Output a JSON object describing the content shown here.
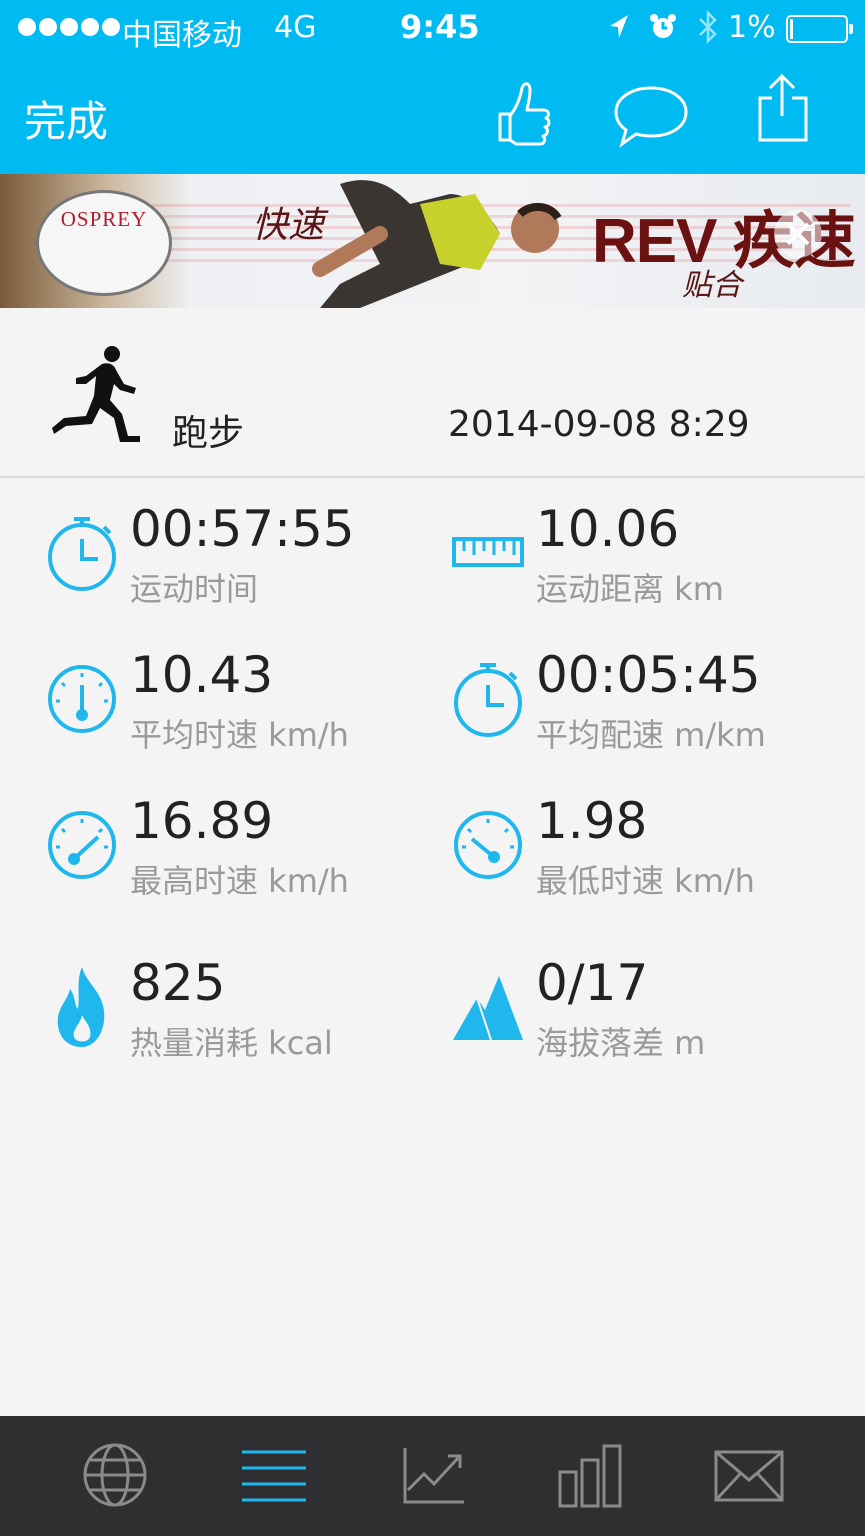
{
  "status_bar": {
    "carrier": "中国移动",
    "network": "4G",
    "time": "9:45",
    "battery": "1%"
  },
  "nav": {
    "done_label": "完成",
    "icons": [
      "thumbs-up-icon",
      "comment-icon",
      "share-icon"
    ]
  },
  "ad": {
    "logo": "OSPREY",
    "tagline_1": "快速",
    "brand": "REV 疾速",
    "tagline_2": "贴合"
  },
  "activity": {
    "type": "跑步",
    "datetime": "2014-09-08 8:29"
  },
  "stats": [
    {
      "value": "00:57:55",
      "label": "运动时间",
      "icon": "stopwatch-icon"
    },
    {
      "value": "10.06",
      "label": "运动距离 km",
      "icon": "ruler-icon"
    },
    {
      "value": "10.43",
      "label": "平均时速 km/h",
      "icon": "gauge-icon"
    },
    {
      "value": "00:05:45",
      "label": "平均配速 m/km",
      "icon": "stopwatch-icon"
    },
    {
      "value": "16.89",
      "label": "最高时速 km/h",
      "icon": "speedometer-high-icon"
    },
    {
      "value": "1.98",
      "label": "最低时速 km/h",
      "icon": "speedometer-low-icon"
    },
    {
      "value": "825",
      "label": "热量消耗 kcal",
      "icon": "flame-icon"
    },
    {
      "value": "0/17",
      "label": "海拔落差 m",
      "icon": "mountain-icon"
    }
  ],
  "tabbar": {
    "tabs": [
      "globe-icon",
      "list-icon",
      "trend-chart-icon",
      "bar-chart-icon",
      "mail-icon"
    ],
    "active_index": 1
  },
  "colors": {
    "accent": "#00baf2",
    "tabbar_bg": "#2f2f31",
    "background": "#f4f4f4"
  }
}
